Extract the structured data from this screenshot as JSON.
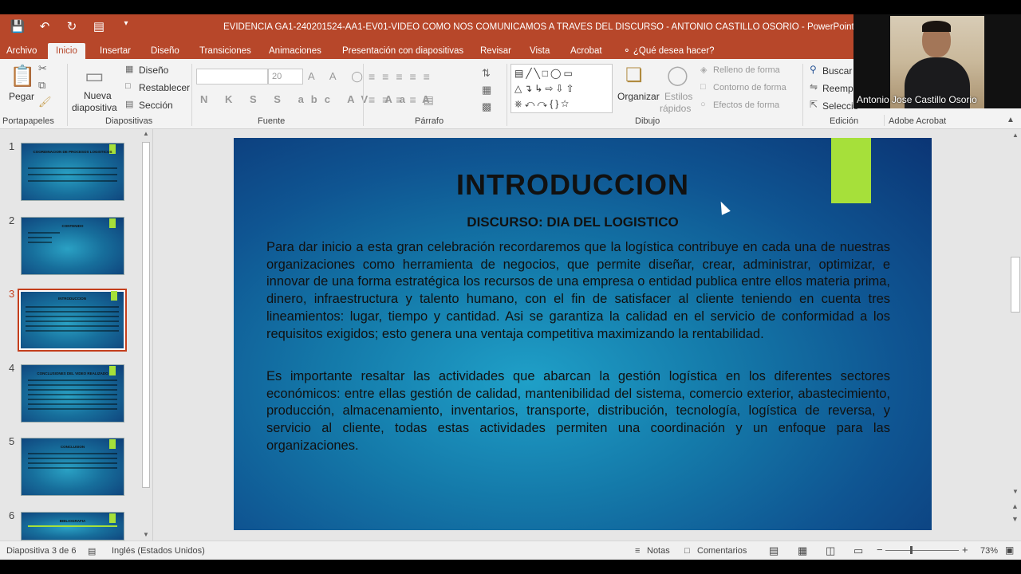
{
  "window": {
    "title": "EVIDENCIA GA1-240201524-AA1-EV01-VIDEO COMO NOS COMUNICAMOS A TRAVES DEL DISCURSO - ANTONIO CASTILLO OSORIO - PowerPoint"
  },
  "qat": [
    "save-icon",
    "undo-icon",
    "redo-icon",
    "present-icon",
    "customize-icon"
  ],
  "tabs": [
    "Archivo",
    "Inicio",
    "Insertar",
    "Diseño",
    "Transiciones",
    "Animaciones",
    "Presentación con diapositivas",
    "Revisar",
    "Vista",
    "Acrobat"
  ],
  "tell_me": "¿Qué desea hacer?",
  "ribbon": {
    "paste": "Pegar",
    "new_slide_1": "Nueva",
    "new_slide_2": "diapositiva",
    "layout": "Diseño",
    "reset": "Restablecer",
    "section": "Sección",
    "font_size": "20",
    "arrange": "Organizar",
    "styles_1": "Estilos",
    "styles_2": "rápidos",
    "shape_fill": "Relleno de forma",
    "shape_outline": "Contorno de forma",
    "shape_effects": "Efectos de forma",
    "find": "Buscar",
    "replace": "Reempl",
    "select": "Seleccio",
    "groups": {
      "clipboard": "Portapapeles",
      "slides": "Diapositivas",
      "font": "Fuente",
      "paragraph": "Párrafo",
      "drawing": "Dibujo",
      "editing": "Edición",
      "adobe": "Adobe Acrobat"
    }
  },
  "webcam": {
    "name": "Antonio Jose Castillo Osorio"
  },
  "thumbnails": [
    {
      "num": "1",
      "title": "COORDINACION DE PROCESOS LOGISTICOS"
    },
    {
      "num": "2",
      "title": "CONTENIDO"
    },
    {
      "num": "3",
      "title": "INTRODUCCION"
    },
    {
      "num": "4",
      "title": "CONCLUSIONES DEL VIDEO REALIZADO"
    },
    {
      "num": "5",
      "title": "CONCLUSION"
    },
    {
      "num": "6",
      "title": "BIBLIOGRAFIA"
    }
  ],
  "slide": {
    "title": "INTRODUCCION",
    "subtitle": "DISCURSO: DIA DEL LOGISTICO",
    "paragraph1": "Para dar inicio a esta gran celebración recordaremos que la logística contribuye en cada una de nuestras organizaciones como herramienta de negocios, que permite diseñar, crear, administrar, optimizar, e innovar de una forma estratégica los recursos de una empresa o entidad publica entre ellos materia prima, dinero, infraestructura y talento humano, con el fin de satisfacer al cliente teniendo en cuenta tres lineamientos: lugar, tiempo y cantidad. Asi se garantiza la calidad en el servicio de conformidad a los requisitos exigidos; esto genera una ventaja competitiva maximizando la rentabilidad.",
    "paragraph2": "Es importante resaltar las actividades que abarcan la gestión logística en los diferentes sectores económicos: entre ellas gestión de calidad, mantenibilidad del sistema, comercio exterior, abastecimiento, producción, almacenamiento, inventarios, transporte, distribución, tecnología, logística de reversa, y servicio al cliente, todas estas actividades permiten una coordinación y un enfoque para las organizaciones."
  },
  "status": {
    "slide_info": "Diapositiva 3 de 6",
    "language": "Inglés (Estados Unidos)",
    "notes": "Notas",
    "comments": "Comentarios",
    "zoom": "73%"
  }
}
